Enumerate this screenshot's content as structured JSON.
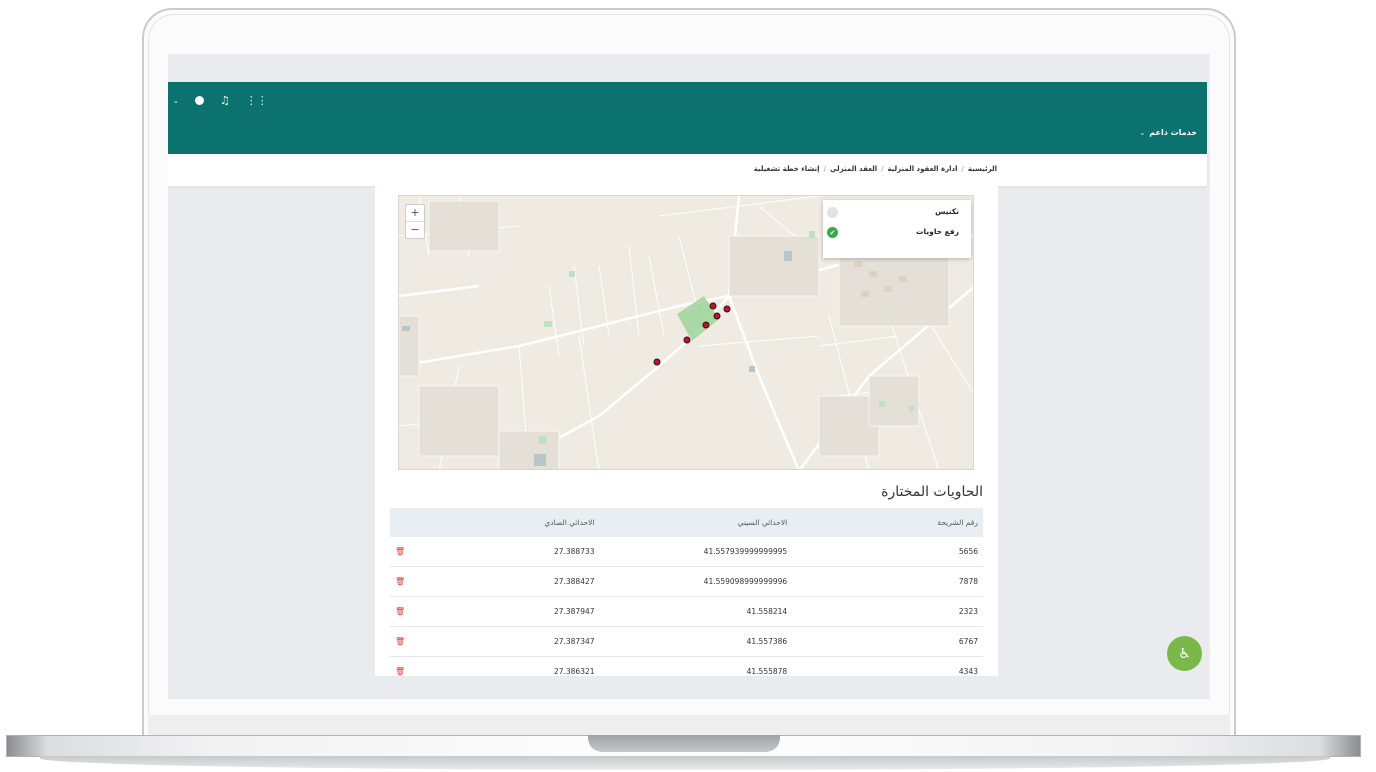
{
  "header": {
    "brand_menu": "خدمات داعم",
    "icons": [
      "grid-icon",
      "bell-icon",
      "globe-icon"
    ]
  },
  "breadcrumb": [
    "الرئيسية",
    "ادارة العقود المنزلية",
    "العقد المنزلي",
    "إنشاء خطة تشغيلية"
  ],
  "map": {
    "zoom_in": "+",
    "zoom_out": "−",
    "layers": [
      {
        "label": "تكنيس",
        "checked": false
      },
      {
        "label": "رفع حاويات",
        "checked": true
      }
    ]
  },
  "section": {
    "title": "الحاويات المختارة"
  },
  "table": {
    "headers": [
      "رقم الشريحة",
      "الاحداثي السيني",
      "الاحداثي الصادي"
    ],
    "rows": [
      {
        "parcel": "5656",
        "x": "41.557939999999995",
        "y": "27.388733"
      },
      {
        "parcel": "7878",
        "x": "41.559098999999996",
        "y": "27.388427"
      },
      {
        "parcel": "2323",
        "x": "41.558214",
        "y": "27.387947"
      },
      {
        "parcel": "6767",
        "x": "41.557386",
        "y": "27.387347"
      },
      {
        "parcel": "4343",
        "x": "41.555878",
        "y": "27.386321"
      }
    ]
  },
  "colors": {
    "header_bg": "#0b726d",
    "marker": "#c8102e",
    "delete": "#e03a3a",
    "accessibility": "#7bb84a"
  }
}
